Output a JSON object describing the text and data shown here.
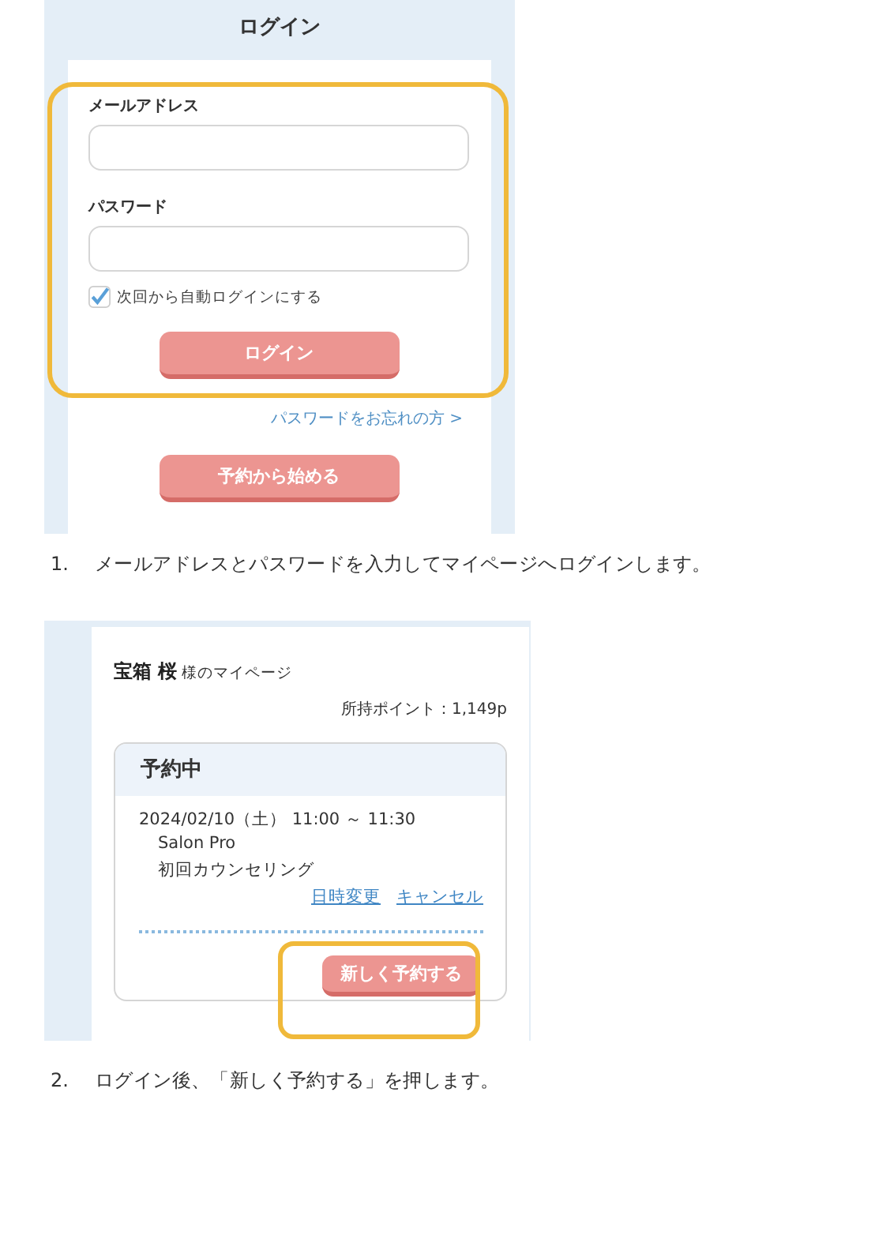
{
  "login_screen": {
    "title": "ログイン",
    "email_label": "メールアドレス",
    "password_label": "パスワード",
    "auto_login": {
      "label": "次回から自動ログインにする",
      "checked": true
    },
    "login_button": "ログイン",
    "forgot_link": "パスワードをお忘れの方 >",
    "start_button": "予約から始める"
  },
  "step_1": {
    "number": "1.",
    "text": "メールアドレスとパスワードを入力してマイページへログインします。"
  },
  "mypage_screen": {
    "user_name": "宝箱 桜",
    "user_suffix": "様のマイページ",
    "points": "所持ポイント：1,149p",
    "reservation": {
      "heading": "予約中",
      "datetime": "2024/02/10（土） 11:00 ～ 11:30",
      "salon": "Salon Pro",
      "menu": "初回カウンセリング",
      "links": [
        "日時変更",
        "キャンセル"
      ]
    },
    "new_button": "新しく予約する"
  },
  "step_2": {
    "number": "2.",
    "text": "ログイン後、「新しく予約する」を押します。"
  }
}
